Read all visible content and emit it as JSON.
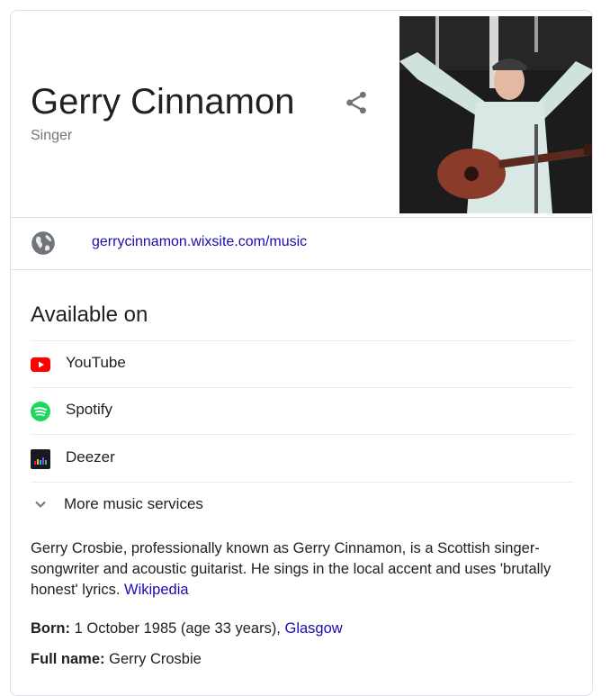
{
  "entity": {
    "name": "Gerry Cinnamon",
    "subtitle": "Singer"
  },
  "website": {
    "url_text": "gerrycinnamon.wixsite.com/music"
  },
  "available_on": {
    "title": "Available on",
    "services": [
      {
        "label": "YouTube",
        "icon": "youtube-icon"
      },
      {
        "label": "Spotify",
        "icon": "spotify-icon"
      },
      {
        "label": "Deezer",
        "icon": "deezer-icon"
      }
    ],
    "more_label": "More music services"
  },
  "description": {
    "text": "Gerry Crosbie, professionally known as Gerry Cinnamon, is a Scottish singer-songwriter and acoustic guitarist. He sings in the local accent and uses 'brutally honest' lyrics.",
    "source_link": "Wikipedia"
  },
  "facts": {
    "born_label": "Born:",
    "born_value": "1 October 1985 (age 33 years),",
    "born_place": "Glasgow",
    "fullname_label": "Full name:",
    "fullname_value": "Gerry Crosbie"
  },
  "colors": {
    "link": "#1a0dab",
    "text": "#202124",
    "muted": "#70757a",
    "youtube": "#ff0000",
    "spotify": "#1ed760",
    "deezer": "#191922"
  }
}
